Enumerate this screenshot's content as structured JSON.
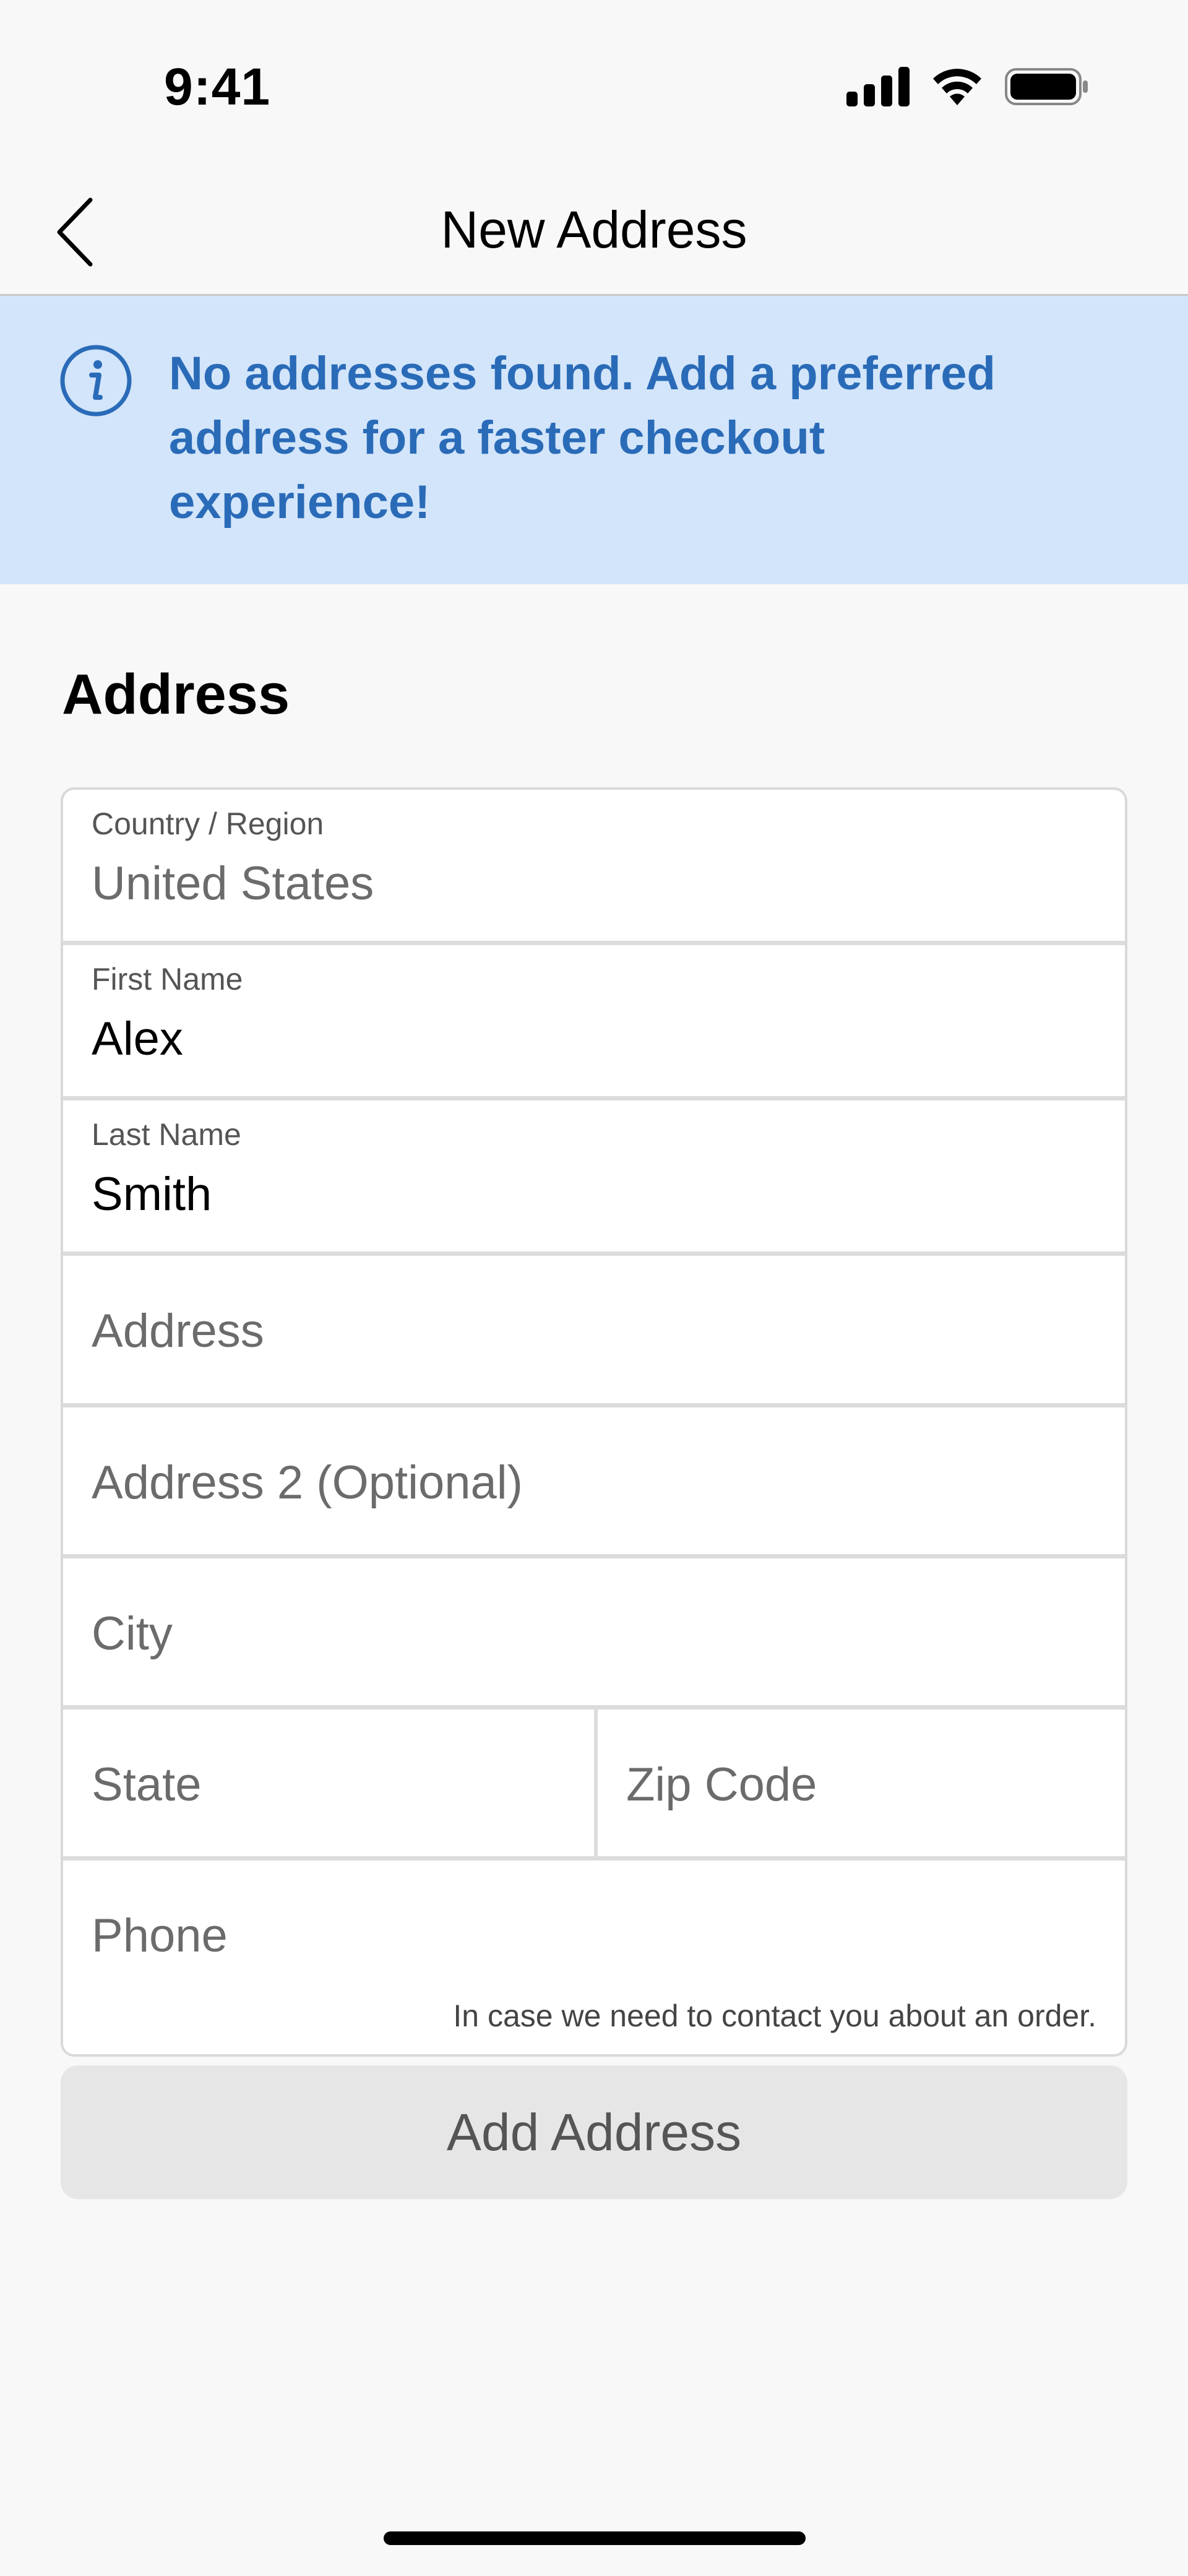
{
  "status_bar": {
    "time": "9:41",
    "icons": [
      "signal-icon",
      "wifi-icon",
      "battery-icon"
    ]
  },
  "nav": {
    "title": "New Address",
    "back_icon": "chevron-left-icon"
  },
  "banner": {
    "icon": "info-icon",
    "message": "No addresses found. Add a preferred address for a faster checkout experience!"
  },
  "section": {
    "title": "Address"
  },
  "form": {
    "country": {
      "label": "Country / Region",
      "value": "United States"
    },
    "first_name": {
      "label": "First Name",
      "value": "Alex"
    },
    "last_name": {
      "label": "Last Name",
      "value": "Smith"
    },
    "address": {
      "placeholder": "Address"
    },
    "address2": {
      "placeholder": "Address 2 (Optional)"
    },
    "city": {
      "placeholder": "City"
    },
    "state": {
      "placeholder": "State"
    },
    "zip": {
      "placeholder": "Zip Code"
    },
    "phone": {
      "placeholder": "Phone",
      "helper": "In case we need to contact you about an order."
    }
  },
  "actions": {
    "add_address_label": "Add Address"
  },
  "colors": {
    "banner_bg": "#d3e5fa",
    "banner_text": "#2a6bb8",
    "button_bg": "#e6e6e6"
  }
}
